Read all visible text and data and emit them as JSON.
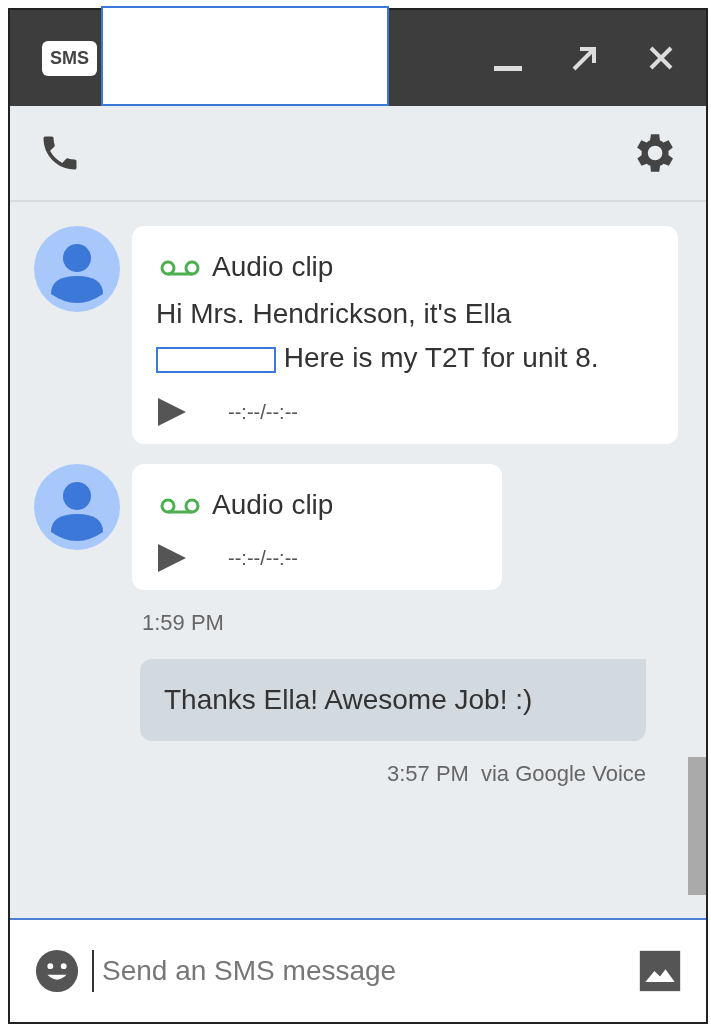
{
  "title_bar": {
    "badge": "SMS"
  },
  "messages": [
    {
      "kind": "clip",
      "label": "Audio clip",
      "text_before": "Hi Mrs. Hendrickson, it's Ella",
      "redacted": true,
      "text_after": "Here is my T2T for unit 8.",
      "duration": "--:--/--:--"
    },
    {
      "kind": "clip",
      "label": "Audio clip",
      "duration": "--:--/--:--",
      "time": "1:59 PM"
    },
    {
      "kind": "sent",
      "text": "Thanks Ella! Awesome Job! :)",
      "time": "3:57 PM",
      "via": "via Google Voice"
    }
  ],
  "composer": {
    "placeholder": "Send an SMS message"
  }
}
